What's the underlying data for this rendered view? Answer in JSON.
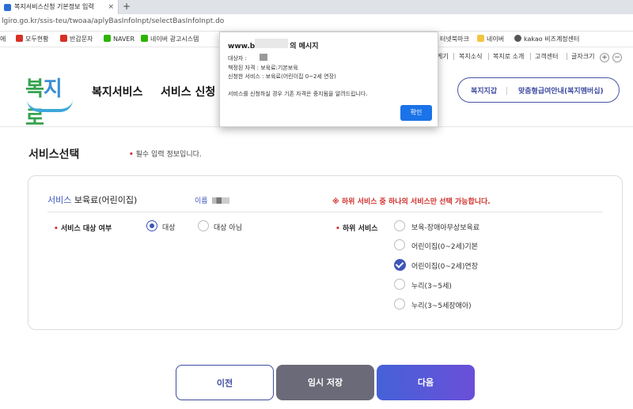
{
  "browser": {
    "tab_title": "복지서비스신청 기본정보 입력",
    "tab_close": "×",
    "new_tab": "+",
    "url": "lgiro.go.kr/ssis-teu/twoaa/aplyBasInfoInpt/selectBasInfoInpt.do",
    "bookmarks": [
      {
        "label": "에",
        "color": "#999999"
      },
      {
        "label": "모두현황",
        "color": "#d93025"
      },
      {
        "label": "반갑문자",
        "color": "#d93025"
      },
      {
        "label": "NAVER",
        "color": "#2db400"
      },
      {
        "label": "네이버 광고시스템",
        "color": "#2db400"
      },
      {
        "label": "터넷북마크",
        "color": "#1a73e8"
      },
      {
        "label": "네이버",
        "color": "#f4c542"
      },
      {
        "label": "kakao 비즈계정센터",
        "color": "#555555"
      }
    ]
  },
  "site": {
    "logo": {
      "b": "복",
      "j": "지",
      "r": "로"
    },
    "util_links": [
      "게기",
      "복지소식",
      "복지로 소개",
      "고객센터",
      "글자크기"
    ],
    "zoom_in": "+",
    "zoom_out": "−",
    "gnb": [
      "복지서비스",
      "서비스 신청"
    ],
    "pill": {
      "left": "복지지갑",
      "right": "맞춤형급여안내(복지멤버십)"
    }
  },
  "form": {
    "section_title": "서비스선택",
    "required_note": "필수 입력 정보입니다.",
    "service_prefix": "서비스",
    "service_name": "보육료(어린이집)",
    "name_label": "이름",
    "warning": "※ 하위 서비스 중 하나의 서비스만 선택 가능합니다.",
    "target_label": "서비스 대상 여부",
    "target_options": [
      {
        "label": "대상",
        "selected": true
      },
      {
        "label": "대상 아님",
        "selected": false
      }
    ],
    "sub_label": "하위 서비스",
    "sub_options": [
      {
        "label": "보육-장애아무상보육료",
        "selected": false
      },
      {
        "label": "어린이집(0~2세)기본",
        "selected": false
      },
      {
        "label": "어린이집(0~2세)연장",
        "selected": true
      },
      {
        "label": "누리(3~5세)",
        "selected": false
      },
      {
        "label": "누리(3~5세장애아)",
        "selected": false
      }
    ],
    "red_dot": "•"
  },
  "buttons": {
    "prev": "이전",
    "temp_save": "임시 저장",
    "next": "다음"
  },
  "dialog": {
    "title_prefix": "www.b",
    "title_suffix": "의 메시지",
    "recipient": "대상자 :",
    "qualification": "책정된 자격 : 보육료:기본보육",
    "applied_service": "신청한 서비스 : 보육료(어린이집 0~2세 연장)",
    "notice": "서비스를 신청하실 경우 기존 자격은 중지됨을 알려드립니다.",
    "ok": "확인"
  }
}
